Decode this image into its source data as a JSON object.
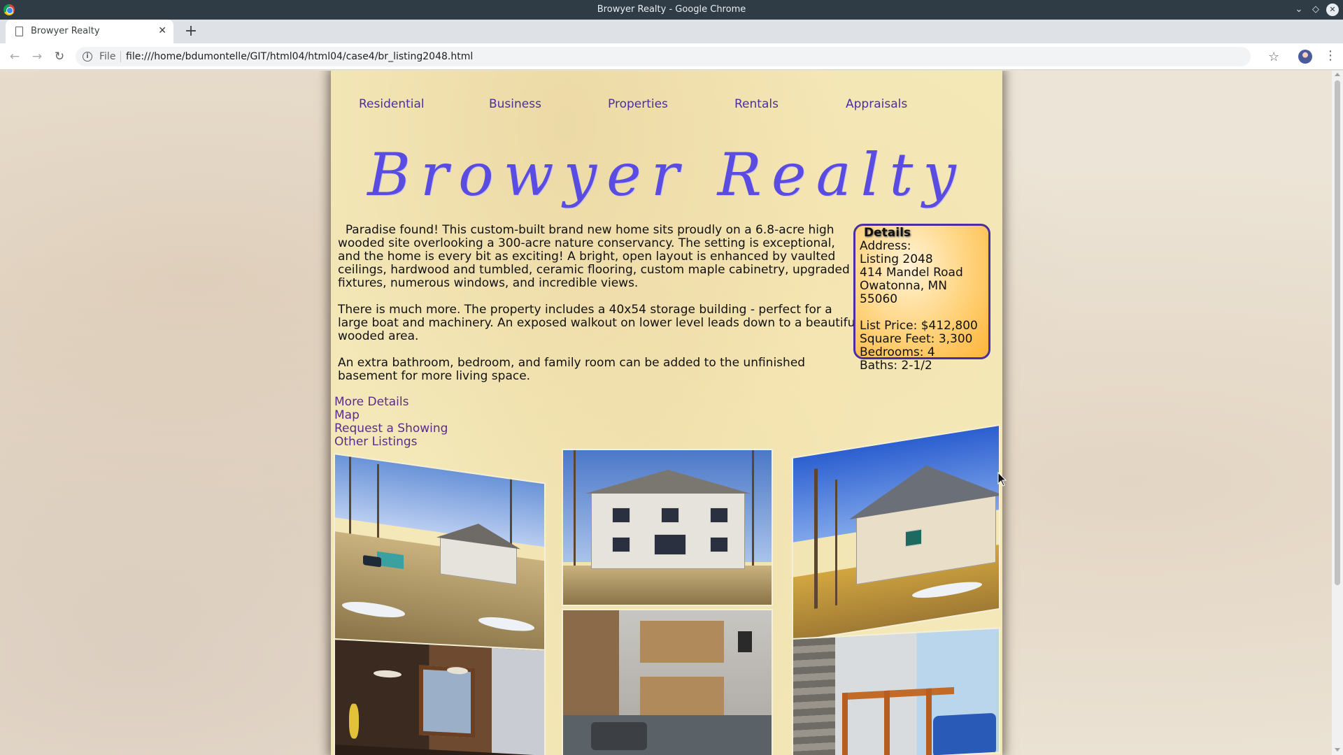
{
  "window": {
    "title": "Browyer Realty - Google Chrome"
  },
  "tab": {
    "title": "Browyer Realty"
  },
  "toolbar": {
    "scheme_chip": "File",
    "url": "file:///home/bdumontelle/GIT/html04/html04/case4/br_listing2048.html"
  },
  "nav": {
    "items": [
      "Residential",
      "Business",
      "Properties",
      "Rentals",
      "Appraisals"
    ]
  },
  "logo": {
    "text": "Browyer Realty"
  },
  "description": {
    "paragraphs": [
      "Paradise found! This custom-built brand new home sits proudly on a 6.8-acre high wooded site overlooking a 300-acre nature conservancy. The setting is exceptional, and the home is every bit as exciting! A bright, open layout is enhanced by vaulted ceilings, hardwood and tumbled, ceramic flooring, custom maple cabinetry, upgraded fixtures, numerous windows, and incredible views.",
      "There is much more. The property includes a 40x54 storage building - perfect for a large boat and machinery. An exposed walkout on lower level leads down to a beautiful wooded area.",
      "An extra bathroom, bedroom, and family room can be added to the unfinished basement for more living space."
    ]
  },
  "details": {
    "title": "Details",
    "address_label": "Address:",
    "listing": "Listing 2048",
    "street": "414 Mandel Road",
    "city": "Owatonna, MN 55060",
    "price": "List Price: $412,800",
    "sqft": "Square Feet: 3,300",
    "bedrooms": "Bedrooms: 4",
    "baths": "Baths: 2-1/2"
  },
  "links": [
    "More Details",
    "Map",
    "Request a Showing",
    "Other Listings"
  ],
  "colors": {
    "link": "#4a2fa0",
    "logo": "#5a4ce0",
    "details_border": "#4a2fa0",
    "details_fill": "#ffc45a",
    "page_bg": "#f4e8b8"
  }
}
